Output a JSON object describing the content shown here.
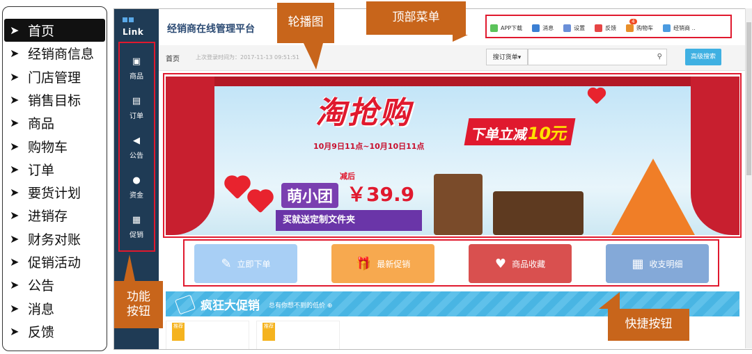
{
  "outline_menu": {
    "items": [
      {
        "label": "首页",
        "active": true
      },
      {
        "label": "经销商信息"
      },
      {
        "label": "门店管理"
      },
      {
        "label": "销售目标"
      },
      {
        "label": "商品"
      },
      {
        "label": "购物车"
      },
      {
        "label": "订单"
      },
      {
        "label": "要货计划"
      },
      {
        "label": "进销存"
      },
      {
        "label": "财务对账"
      },
      {
        "label": "促销活动"
      },
      {
        "label": "公告"
      },
      {
        "label": "消息"
      },
      {
        "label": "反馈"
      }
    ],
    "arrow": "➤"
  },
  "app": {
    "logo_text": "Link",
    "title": "经销商在线管理平台",
    "sidebar": [
      {
        "label": "商品",
        "icon": "bag-icon"
      },
      {
        "label": "订单",
        "icon": "document-icon"
      },
      {
        "label": "公告",
        "icon": "megaphone-icon"
      },
      {
        "label": "资金",
        "icon": "moneybag-icon"
      },
      {
        "label": "促销",
        "icon": "gift-icon"
      }
    ],
    "topnav": [
      {
        "label": "APP下载",
        "icon": "phone-icon",
        "color": "#5cc35b"
      },
      {
        "label": "消息",
        "icon": "chat-icon",
        "color": "#3b7fd3"
      },
      {
        "label": "设置",
        "icon": "gear-icon",
        "color": "#6a8fd8"
      },
      {
        "label": "反馈",
        "icon": "smile-icon",
        "color": "#e64545"
      },
      {
        "label": "购物车",
        "icon": "cart-icon",
        "color": "#e88f2a",
        "badge": "4"
      },
      {
        "label": "经销商 ..",
        "icon": "user-icon",
        "color": "#4b9be0"
      }
    ],
    "crumb": {
      "home": "首页",
      "last_login": "上次登录时间为：2017-11-13 09:51:51"
    },
    "search": {
      "select_label": "搜订货单▾",
      "placeholder": "",
      "icon": "search-icon",
      "advanced": "高级搜索"
    },
    "banner": {
      "headline": "淘抢购",
      "sub": "下单立减",
      "sub_amount": "10元",
      "date": "10月9日11点~10月10日11点",
      "less_label": "减后",
      "product": "萌小团",
      "price": "￥39.9",
      "gift": "买就送定制文件夹"
    },
    "quick_buttons": [
      {
        "label": "立即下单",
        "icon": "✎",
        "color": "#a8cff5"
      },
      {
        "label": "最新促销",
        "icon": "🎁",
        "color": "#f7a94f"
      },
      {
        "label": "商品收藏",
        "icon": "♥",
        "color": "#d9504f"
      },
      {
        "label": "收支明细",
        "icon": "▦",
        "color": "#84a9d8"
      }
    ],
    "promo": {
      "title": "疯狂大促销",
      "subtitle": "总有你想不到的低价 ⊕"
    },
    "cards": [
      {
        "badge": "推荐"
      },
      {
        "badge": "推荐"
      }
    ]
  },
  "callouts": {
    "carousel": "轮播图",
    "top_menu": "顶部菜单",
    "function_buttons": "功能按钮",
    "quick_buttons": "快捷按钮"
  }
}
